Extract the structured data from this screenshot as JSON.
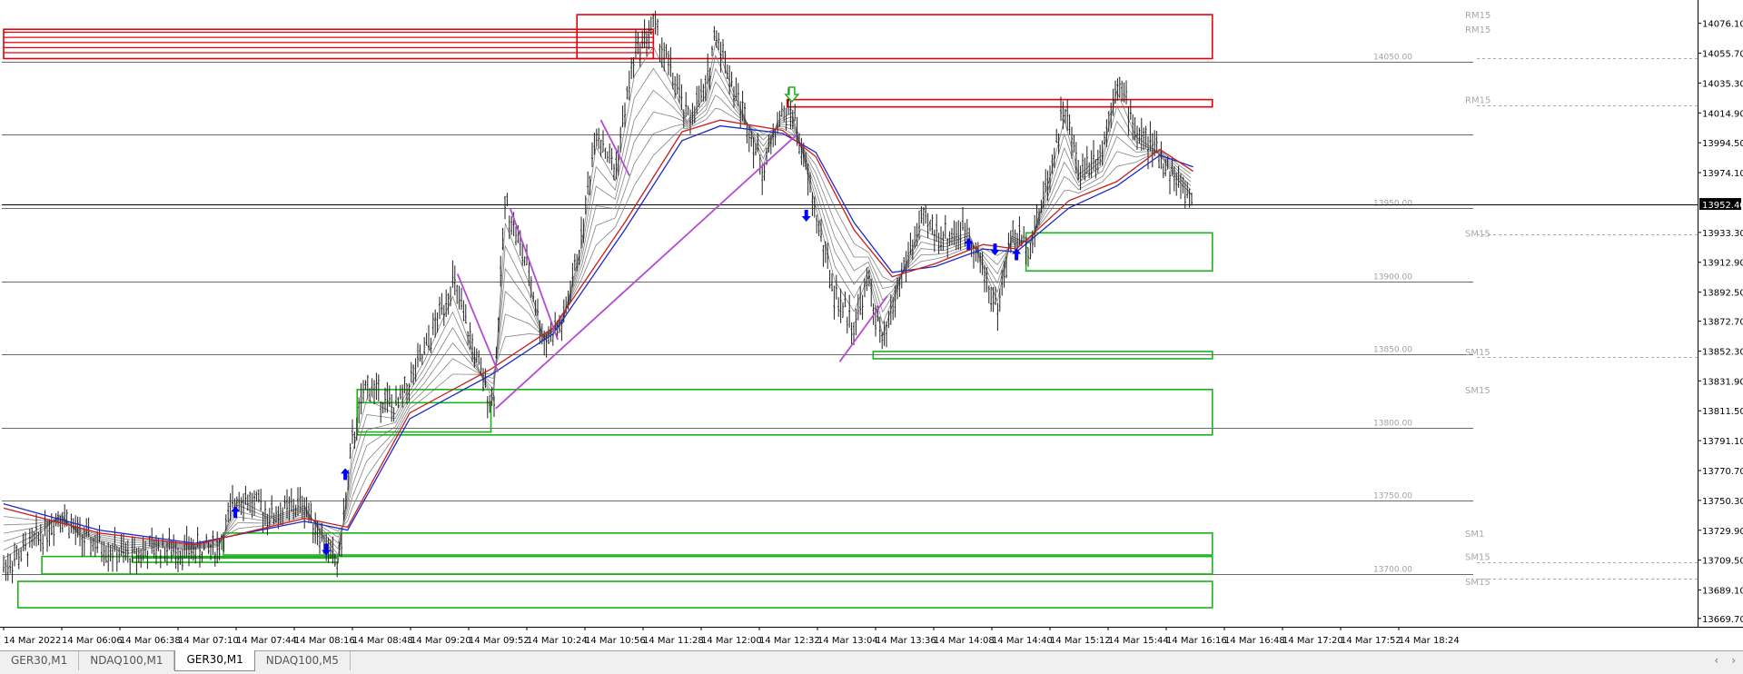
{
  "chart_data": {
    "type": "candlestick",
    "symbol": "GER30,M1",
    "price_axis": {
      "ticks": [
        "14076.10",
        "14055.70",
        "14035.30",
        "14014.90",
        "13994.50",
        "13974.10",
        "13933.30",
        "13912.90",
        "13892.50",
        "13872.70",
        "13852.30",
        "13831.90",
        "13811.50",
        "13791.10",
        "13770.70",
        "13750.30",
        "13729.90",
        "13709.50",
        "13689.10",
        "13669.70"
      ],
      "current_price": "13952.40",
      "ylim": [
        13664,
        14092
      ]
    },
    "time_axis": {
      "ticks": [
        "14 Mar 2022",
        "14 Mar 06:06",
        "14 Mar 06:38",
        "14 Mar 07:10",
        "14 Mar 07:44",
        "14 Mar 08:16",
        "14 Mar 08:48",
        "14 Mar 09:20",
        "14 Mar 09:52",
        "14 Mar 10:24",
        "14 Mar 10:56",
        "14 Mar 11:28",
        "14 Mar 12:00",
        "14 Mar 12:32",
        "14 Mar 13:04",
        "14 Mar 13:36",
        "14 Mar 14:08",
        "14 Mar 14:40",
        "14 Mar 15:12",
        "14 Mar 15:44",
        "14 Mar 16:16",
        "14 Mar 16:48",
        "14 Mar 17:20",
        "14 Mar 17:52",
        "14 Mar 18:24"
      ]
    },
    "price_path": [
      {
        "t": 0.0,
        "p": 13705
      },
      {
        "t": 0.6,
        "p": 13720
      },
      {
        "t": 1.2,
        "p": 13742
      },
      {
        "t": 1.6,
        "p": 13725
      },
      {
        "t": 2.0,
        "p": 13720
      },
      {
        "t": 2.6,
        "p": 13712
      },
      {
        "t": 3.2,
        "p": 13718
      },
      {
        "t": 3.8,
        "p": 13716
      },
      {
        "t": 4.5,
        "p": 13718
      },
      {
        "t": 4.9,
        "p": 13755
      },
      {
        "t": 5.6,
        "p": 13740
      },
      {
        "t": 6.3,
        "p": 13748
      },
      {
        "t": 6.7,
        "p": 13722
      },
      {
        "t": 7.0,
        "p": 13705
      },
      {
        "t": 7.3,
        "p": 13790
      },
      {
        "t": 7.6,
        "p": 13830
      },
      {
        "t": 8.2,
        "p": 13812
      },
      {
        "t": 8.8,
        "p": 13850
      },
      {
        "t": 9.4,
        "p": 13900
      },
      {
        "t": 10.0,
        "p": 13835
      },
      {
        "t": 10.25,
        "p": 13815
      },
      {
        "t": 10.5,
        "p": 13955
      },
      {
        "t": 11.0,
        "p": 13905
      },
      {
        "t": 11.3,
        "p": 13860
      },
      {
        "t": 11.7,
        "p": 13870
      },
      {
        "t": 12.1,
        "p": 13930
      },
      {
        "t": 12.4,
        "p": 14005
      },
      {
        "t": 12.8,
        "p": 13975
      },
      {
        "t": 13.2,
        "p": 14055
      },
      {
        "t": 13.6,
        "p": 14075
      },
      {
        "t": 14.0,
        "p": 14040
      },
      {
        "t": 14.3,
        "p": 14010
      },
      {
        "t": 14.7,
        "p": 14030
      },
      {
        "t": 14.9,
        "p": 14072
      },
      {
        "t": 15.3,
        "p": 14030
      },
      {
        "t": 15.6,
        "p": 14005
      },
      {
        "t": 15.9,
        "p": 13975
      },
      {
        "t": 16.2,
        "p": 14010
      },
      {
        "t": 16.5,
        "p": 14018
      },
      {
        "t": 16.7,
        "p": 13990
      },
      {
        "t": 17.0,
        "p": 13945
      },
      {
        "t": 17.4,
        "p": 13890
      },
      {
        "t": 17.8,
        "p": 13870
      },
      {
        "t": 18.1,
        "p": 13900
      },
      {
        "t": 18.4,
        "p": 13855
      },
      {
        "t": 18.8,
        "p": 13905
      },
      {
        "t": 19.2,
        "p": 13940
      },
      {
        "t": 19.7,
        "p": 13930
      },
      {
        "t": 20.2,
        "p": 13935
      },
      {
        "t": 20.8,
        "p": 13880
      },
      {
        "t": 21.1,
        "p": 13932
      },
      {
        "t": 21.5,
        "p": 13925
      },
      {
        "t": 21.9,
        "p": 13975
      },
      {
        "t": 22.2,
        "p": 14020
      },
      {
        "t": 22.5,
        "p": 13975
      },
      {
        "t": 23.0,
        "p": 13990
      },
      {
        "t": 23.3,
        "p": 14040
      },
      {
        "t": 23.7,
        "p": 14002
      },
      {
        "t": 24.1,
        "p": 13990
      },
      {
        "t": 24.6,
        "p": 13966
      },
      {
        "t": 24.9,
        "p": 13955
      }
    ],
    "ma_red": [
      {
        "t": 0.0,
        "p": 13745
      },
      {
        "t": 2.0,
        "p": 13728
      },
      {
        "t": 4.0,
        "p": 13720
      },
      {
        "t": 6.3,
        "p": 13738
      },
      {
        "t": 7.2,
        "p": 13732
      },
      {
        "t": 8.5,
        "p": 13810
      },
      {
        "t": 10.2,
        "p": 13840
      },
      {
        "t": 11.5,
        "p": 13868
      },
      {
        "t": 13.0,
        "p": 13940
      },
      {
        "t": 14.2,
        "p": 14002
      },
      {
        "t": 15.0,
        "p": 14010
      },
      {
        "t": 16.3,
        "p": 14003
      },
      {
        "t": 17.0,
        "p": 13985
      },
      {
        "t": 17.8,
        "p": 13935
      },
      {
        "t": 18.6,
        "p": 13903
      },
      {
        "t": 19.5,
        "p": 13912
      },
      {
        "t": 20.5,
        "p": 13925
      },
      {
        "t": 21.2,
        "p": 13922
      },
      {
        "t": 22.3,
        "p": 13955
      },
      {
        "t": 23.3,
        "p": 13968
      },
      {
        "t": 24.2,
        "p": 13990
      },
      {
        "t": 24.9,
        "p": 13975
      }
    ],
    "ma_blue": [
      {
        "t": 0.0,
        "p": 13748
      },
      {
        "t": 2.0,
        "p": 13730
      },
      {
        "t": 4.0,
        "p": 13721
      },
      {
        "t": 6.3,
        "p": 13736
      },
      {
        "t": 7.2,
        "p": 13730
      },
      {
        "t": 8.5,
        "p": 13806
      },
      {
        "t": 10.2,
        "p": 13836
      },
      {
        "t": 11.5,
        "p": 13864
      },
      {
        "t": 13.0,
        "p": 13935
      },
      {
        "t": 14.2,
        "p": 13996
      },
      {
        "t": 15.0,
        "p": 14006
      },
      {
        "t": 16.3,
        "p": 14001
      },
      {
        "t": 17.0,
        "p": 13988
      },
      {
        "t": 17.8,
        "p": 13940
      },
      {
        "t": 18.6,
        "p": 13906
      },
      {
        "t": 19.5,
        "p": 13910
      },
      {
        "t": 20.5,
        "p": 13922
      },
      {
        "t": 21.2,
        "p": 13920
      },
      {
        "t": 22.3,
        "p": 13950
      },
      {
        "t": 23.3,
        "p": 13965
      },
      {
        "t": 24.2,
        "p": 13986
      },
      {
        "t": 24.9,
        "p": 13978
      }
    ],
    "horizontal_levels": [
      {
        "price": 14050.0,
        "label": "14050.00"
      },
      {
        "price": 14000.0,
        "label": ""
      },
      {
        "price": 13950.0,
        "label": "13950.00"
      },
      {
        "price": 13900.0,
        "label": "13900.00"
      },
      {
        "price": 13850.0,
        "label": "13850.00"
      },
      {
        "price": 13800.0,
        "label": "13800.00"
      },
      {
        "price": 13750.0,
        "label": "13750.00"
      },
      {
        "price": 13700.0,
        "label": "13700.00"
      }
    ],
    "dashed_levels": [
      14052.0,
      14020.0,
      13932.0,
      13848.0,
      13708.0,
      13697.0
    ],
    "zones": [
      {
        "kind": "resistance",
        "label": "RM15",
        "t1": 0.0,
        "t2": 13.6,
        "top": 14072,
        "bottom": 14052
      },
      {
        "kind": "resistance",
        "label": "RM15",
        "t1": 12.0,
        "t2": 25.3,
        "top": 14082,
        "bottom": 14052
      },
      {
        "kind": "resistance",
        "label": "RM15",
        "t1": 16.4,
        "t2": 25.3,
        "top": 14024,
        "bottom": 14019
      },
      {
        "kind": "support",
        "label": "SM15",
        "t1": 21.4,
        "t2": 25.3,
        "top": 13933,
        "bottom": 13907
      },
      {
        "kind": "support",
        "label": "SM15",
        "t1": 18.2,
        "t2": 25.3,
        "top": 13852,
        "bottom": 13847
      },
      {
        "kind": "support",
        "label": "SM15",
        "t1": 7.4,
        "t2": 25.3,
        "top": 13826,
        "bottom": 13795
      },
      {
        "kind": "support",
        "label": "",
        "t1": 7.4,
        "t2": 10.2,
        "top": 13817,
        "bottom": 13797
      },
      {
        "kind": "support",
        "label": "SM1",
        "t1": 4.6,
        "t2": 25.3,
        "top": 13728,
        "bottom": 13713
      },
      {
        "kind": "support",
        "label": "SM15",
        "t1": 0.8,
        "t2": 25.3,
        "top": 13712,
        "bottom": 13700
      },
      {
        "kind": "support",
        "label": "SM15",
        "t1": 0.3,
        "t2": 25.3,
        "top": 13695,
        "bottom": 13677
      },
      {
        "kind": "support",
        "label": "",
        "t1": 2.7,
        "t2": 7.0,
        "top": 13711,
        "bottom": 13708
      }
    ],
    "trendlines": [
      {
        "t1": 10.3,
        "p1": 13813,
        "t2": 16.6,
        "p2": 14000
      },
      {
        "t1": 9.5,
        "p1": 13905,
        "t2": 10.35,
        "p2": 13838
      },
      {
        "t1": 10.6,
        "p1": 13950,
        "t2": 11.6,
        "p2": 13860
      },
      {
        "t1": 12.5,
        "p1": 14010,
        "t2": 13.1,
        "p2": 13972
      },
      {
        "t1": 17.5,
        "p1": 13845,
        "t2": 18.5,
        "p2": 13890
      }
    ],
    "arrows": [
      {
        "t": 4.85,
        "p": 13742,
        "dir": "up"
      },
      {
        "t": 6.75,
        "p": 13717,
        "dir": "down"
      },
      {
        "t": 7.15,
        "p": 13768,
        "dir": "up"
      },
      {
        "t": 16.8,
        "p": 13945,
        "dir": "down"
      },
      {
        "t": 20.2,
        "p": 13925,
        "dir": "up"
      },
      {
        "t": 20.75,
        "p": 13922,
        "dir": "down"
      },
      {
        "t": 21.2,
        "p": 13918,
        "dir": "up"
      }
    ],
    "marker": {
      "t": 16.5,
      "p": 14025,
      "kind": "hollow-down-arrow"
    }
  },
  "tabs": [
    {
      "label": "GER30,M1",
      "active": false
    },
    {
      "label": "NDAQ100,M1",
      "active": false
    },
    {
      "label": "GER30,M1",
      "active": true
    },
    {
      "label": "NDAQ100,M5",
      "active": false
    }
  ],
  "scroll": {
    "left": "‹",
    "right": "›"
  },
  "colors": {
    "candle": "#1f1f1f",
    "resistance": "#e8000b",
    "support": "#19b319",
    "trend": "#b44bd2",
    "arrow": "#0000ff",
    "ma_red": "#c81e1e",
    "ma_blue": "#1e28c8",
    "ribbon": "#6e6e6e"
  }
}
